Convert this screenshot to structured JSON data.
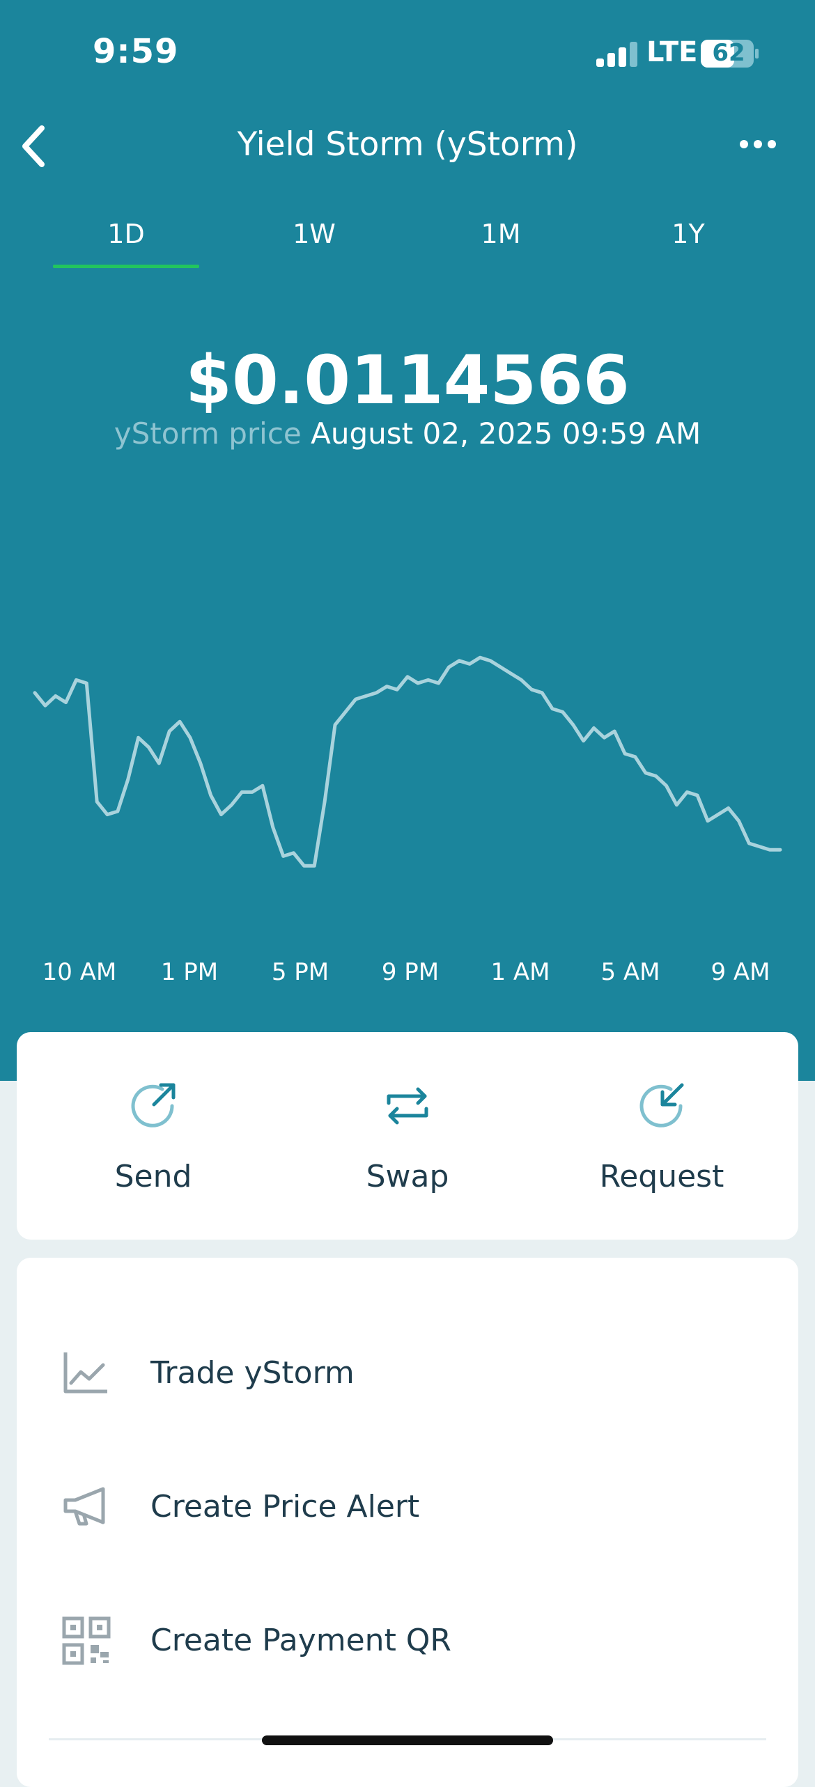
{
  "status_bar": {
    "time": "9:59",
    "network": "LTE",
    "battery": "62"
  },
  "header": {
    "title": "Yield Storm (yStorm)"
  },
  "tabs": [
    {
      "label": "1D",
      "active": true
    },
    {
      "label": "1W",
      "active": false
    },
    {
      "label": "1M",
      "active": false
    },
    {
      "label": "1Y",
      "active": false
    }
  ],
  "price": {
    "value": "$0.0114566",
    "label": "yStorm price",
    "datetime": "August 02, 2025 09:59 AM"
  },
  "chart_data": {
    "type": "line",
    "x": [
      "10 AM",
      "1 PM",
      "5 PM",
      "9 PM",
      "1 AM",
      "5 AM",
      "9 AM"
    ],
    "series": [
      {
        "values": [
          62,
          58,
          61,
          59,
          66,
          65,
          28,
          24,
          25,
          35,
          48,
          45,
          40,
          50,
          53,
          48,
          40,
          30,
          24,
          27,
          31,
          31,
          33,
          20,
          11,
          12,
          8,
          8,
          28,
          52,
          56,
          60,
          61,
          62,
          64,
          63,
          67,
          65,
          66,
          65,
          70,
          72,
          71,
          73,
          72,
          70,
          68,
          66,
          63,
          62,
          57,
          56,
          52,
          47,
          51,
          48,
          50,
          43,
          42,
          37,
          36,
          33,
          27,
          31,
          30,
          22,
          24,
          26,
          22,
          15,
          14,
          13,
          13
        ]
      }
    ],
    "ylim": [
      0,
      100
    ],
    "color": "#a9d3dd",
    "grid": false
  },
  "actions": [
    {
      "label": "Send",
      "icon": "send-icon"
    },
    {
      "label": "Swap",
      "icon": "swap-icon"
    },
    {
      "label": "Request",
      "icon": "request-icon"
    }
  ],
  "menu": [
    {
      "label": "Trade yStorm",
      "icon": "trade-chart-icon"
    },
    {
      "label": "Create Price Alert",
      "icon": "megaphone-icon"
    },
    {
      "label": "Create Payment QR",
      "icon": "qr-code-icon"
    }
  ],
  "colors": {
    "primary": "#1b859c",
    "tab_active": "#22c55e",
    "line": "#a9d3dd",
    "text_dark": "#1f3c4c"
  }
}
